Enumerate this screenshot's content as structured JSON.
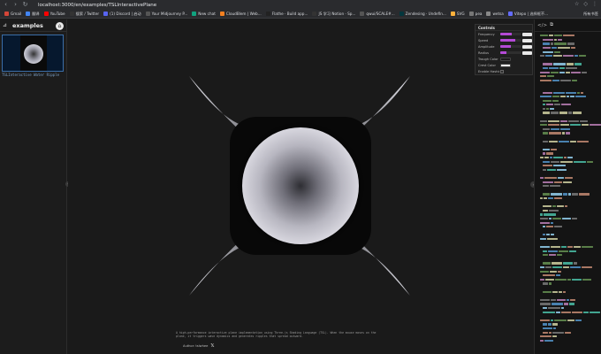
{
  "browser": {
    "url": "localhost:3000/en/examples/TSLInteractivePlane",
    "nav_back_icon": "back-arrow-icon",
    "nav_forward_icon": "forward-arrow-icon",
    "reload_icon": "reload-icon"
  },
  "bookmarks": [
    {
      "label": "Gmail",
      "color": "#d44638"
    },
    {
      "label": "翻译",
      "color": "#4285f4"
    },
    {
      "label": "YouTube",
      "color": "#ff0000"
    },
    {
      "label": "搜索 / Twitter",
      "color": "#333333"
    },
    {
      "label": "(1) Discord | 启动",
      "color": "#5865f2"
    },
    {
      "label": "Your Midjourney P...",
      "color": "#555555"
    },
    {
      "label": "New chat",
      "color": "#10a37f"
    },
    {
      "label": "CloudBlem | Web...",
      "color": "#f38020"
    },
    {
      "label": "Flathe · Build app...",
      "color": "#222222"
    },
    {
      "label": "JS 学习 Notion · Sp...",
      "color": "#333333"
    },
    {
      "label": "qwui/SCALE#...",
      "color": "#555555"
    },
    {
      "label": "Zendesing · Undefin...",
      "color": "#03363d"
    },
    {
      "label": "SVG",
      "color": "#ffb13b"
    },
    {
      "label": "pea",
      "color": "#777777"
    },
    {
      "label": "wetsa",
      "color": "#888888"
    },
    {
      "label": "Vitepo | 选择框不...",
      "color": "#646cff"
    }
  ],
  "bookmarks_right": "所有书签",
  "sidebar": {
    "title": "examples",
    "thumbnail_label": "TSLInteractive Water Ripple"
  },
  "controls": {
    "title": "Controls",
    "rows": [
      {
        "label": "Frequency",
        "type": "slider",
        "value": 0.55
      },
      {
        "label": "Speed",
        "type": "slider",
        "value": 0.7
      },
      {
        "label": "Amplitude",
        "type": "slider",
        "value": 0.5
      },
      {
        "label": "Radius",
        "type": "slider",
        "value": 0.3
      },
      {
        "label": "Trough Color",
        "type": "color",
        "color": "#1b1b1b"
      },
      {
        "label": "Crest Color",
        "type": "color",
        "color": "#ededed"
      },
      {
        "label": "Enable Hashing",
        "type": "checkbox",
        "value": false
      }
    ]
  },
  "canvas": {
    "description": "A high-performance interactive plane implementation using Three.js Shading Language (TSL). When the mouse moves on the plane, it triggers wave dynamics and generates ripples that spread outward.",
    "credit": "Author: tslwhee",
    "credit_icon": "x-logo-icon"
  },
  "colors": {
    "accent": "#b44ad6",
    "background": "#1a1a1a",
    "sphere": "#d4d3dc"
  }
}
